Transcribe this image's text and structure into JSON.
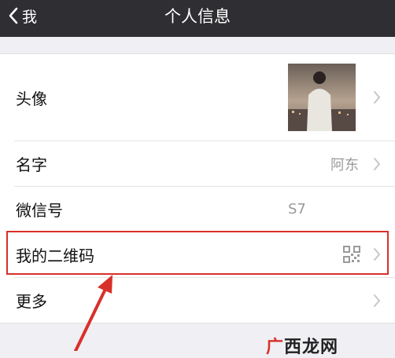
{
  "nav": {
    "back_label": "我",
    "title": "个人信息"
  },
  "rows": [
    {
      "label": "头像",
      "value": ""
    },
    {
      "label": "名字",
      "value": "阿东"
    },
    {
      "label": "微信号",
      "value": "S7"
    },
    {
      "label": "我的二维码",
      "value": ""
    },
    {
      "label": "更多",
      "value": ""
    }
  ],
  "icons": [
    "chevron-left-icon",
    "chevron-right-icon",
    "qr-code-icon"
  ],
  "colors": {
    "nav_bg": "#2f2f33",
    "highlight": "#d8302a",
    "watermark_accent": "#d8302a"
  },
  "watermark": {
    "first_char": "广",
    "rest": "西龙网"
  }
}
